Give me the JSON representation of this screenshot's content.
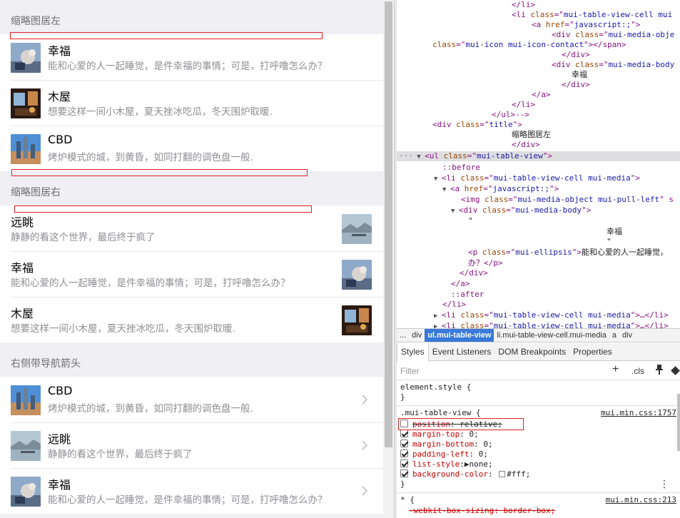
{
  "preview": {
    "section1": {
      "title": "缩略图居左",
      "items": [
        {
          "name": "幸福",
          "desc": "能和心爱的人一起睡觉，是件幸福的事情；可是，打呼噜怎么办？",
          "thumb": "cat-photo"
        },
        {
          "name": "木屋",
          "desc": "想要这样一间小木屋，夏天挫冰吃瓜，冬天围炉取暖.",
          "thumb": "cabin-photo"
        },
        {
          "name": "CBD",
          "desc": "烤炉模式的城，到黄昏，如同打翻的调色盘一般.",
          "thumb": "city-photo"
        }
      ]
    },
    "section2": {
      "title": "缩略图居右",
      "items": [
        {
          "name": "远眺",
          "desc": "静静的看这个世界，最后终于疯了",
          "thumb": "lake-photo"
        },
        {
          "name": "幸福",
          "desc": "能和心爱的人一起睡觉，是件幸福的事情；可是，打呼噜怎么办？",
          "thumb": "cat-photo"
        },
        {
          "name": "木屋",
          "desc": "想要这样一间小木屋，夏天挫冰吃瓜，冬天围炉取暖.",
          "thumb": "cabin-photo"
        }
      ]
    },
    "section3": {
      "title": "右侧带导航箭头",
      "items": [
        {
          "name": "CBD",
          "desc": "烤炉模式的城，到黄昏，如同打翻的调色盘一般.",
          "thumb": "city-photo"
        },
        {
          "name": "远眺",
          "desc": "静静的看这个世界，最后终于疯了",
          "thumb": "lake-photo"
        },
        {
          "name": "幸福",
          "desc": "能和心爱的人一起睡觉，是件幸福的事情；可是，打呼噜怎么办？",
          "thumb": "cat-photo"
        }
      ]
    }
  },
  "devtools": {
    "dom": {
      "l1": "</li>",
      "l2a": "<li ",
      "l2b": "class",
      "l2c": "=\"",
      "l2d": "mui-table-view-cell mui",
      "l2e": "",
      "l3a": "<a ",
      "l3b": "href",
      "l3d": "javascript:;",
      "l3e": "\">",
      "l4a": "<div ",
      "l4b": "class",
      "l4d": "mui-media-obje",
      "l5b": "class",
      "l5d": "mui-icon mui-icon-contact",
      "l5e": "\"></span>",
      "l6": "</div>",
      "l7a": "<div ",
      "l7b": "class",
      "l7d": "mui-media-body",
      "l8": "幸福",
      "l9": "</div>",
      "l10": "</a>",
      "l11": "</li>",
      "l12": "</ul>-->",
      "l13a": "<div ",
      "l13b": "class",
      "l13d": "title",
      "l13e": "\">",
      "l14": "缩略图居左",
      "l15": "</div>",
      "l16a": "<ul ",
      "l16b": "class",
      "l16d": "mui-table-view",
      "l16e": "\">",
      "l17": "::before",
      "l18a": "<li ",
      "l18b": "class",
      "l18d": "mui-table-view-cell mui-media",
      "l18e": "\">",
      "l19a": "<a ",
      "l19b": "href",
      "l19d": "javascript:;",
      "l19e": "\">",
      "l20a": "<img ",
      "l20b": "class",
      "l20d": "mui-media-object mui-pull-left",
      "l20e": "\" s",
      "l21a": "<div ",
      "l21b": "class",
      "l21d": "mui-media-body",
      "l21e": "\">",
      "l22": "\"",
      "l23": "幸福",
      "l24": "\"",
      "l25a": "<p ",
      "l25b": "class",
      "l25d": "mui-ellipsis",
      "l25e": "\">",
      "l25f": "能和心爱的人一起睡觉，",
      "l26": "办？</p>",
      "l27": "</div>",
      "l28": "</a>",
      "l29": "::after",
      "l30": "</li>",
      "l31a": "<li ",
      "l31b": "class",
      "l31d": "mui-table-view-cell mui-media",
      "l31e": "\">…</li>",
      "l32a": "<li ",
      "l32b": "class",
      "l32d": "mui-table-view-cell mui-media",
      "l32e": "\">…</li>",
      "ellipsis": "···"
    },
    "breadcrumbs": [
      "...",
      "div",
      "ul.mui-table-view",
      "li.mui-table-view-cell.mui-media",
      "a",
      "div"
    ],
    "tabs": [
      "Styles",
      "Event Listeners",
      "DOM Breakpoints",
      "Properties"
    ],
    "filter_placeholder": "Filter",
    "plus": "+",
    "cls": ".cls",
    "rules": {
      "element_style": "element.style {",
      "close": "}",
      "rule1_selector": ".mui-table-view {",
      "rule1_source": "mui.min.css:1757",
      "props": [
        {
          "name": "position",
          "value": "relative;",
          "checked": false,
          "struck": true
        },
        {
          "name": "margin-top",
          "value": "0;",
          "checked": true,
          "struck": false
        },
        {
          "name": "margin-bottom",
          "value": "0;",
          "checked": true,
          "struck": false
        },
        {
          "name": "padding-left",
          "value": "0;",
          "checked": true,
          "struck": false
        },
        {
          "name": "list-style",
          "value": "▶none;",
          "checked": true,
          "struck": false
        },
        {
          "name": "background-color",
          "value": "#fff;",
          "checked": true,
          "struck": false
        }
      ],
      "rule2_selector": "* {",
      "rule2_source": "mui.min.css:213",
      "rule2_prop": "-webkit-box-sizing: border-box;"
    },
    "kebab": "⋮"
  },
  "colors": {
    "accent": "#3879d9",
    "annotation_red": "#e02020",
    "tag": "#881280",
    "attr": "#994500",
    "attrval": "#1a1aa6"
  }
}
